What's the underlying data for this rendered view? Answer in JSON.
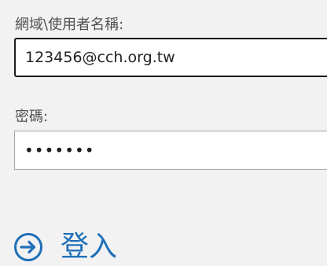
{
  "form": {
    "username_label": "網域\\使用者名稱:",
    "username_value": "123456@cch.org.tw",
    "password_label": "密碼:",
    "password_value": "•••••••",
    "signin_label": "登入"
  },
  "icons": {
    "signin": "arrow-right-circle-icon"
  },
  "colors": {
    "accent": "#1f6fb8",
    "background": "#f2f2f2",
    "label": "#505050"
  }
}
